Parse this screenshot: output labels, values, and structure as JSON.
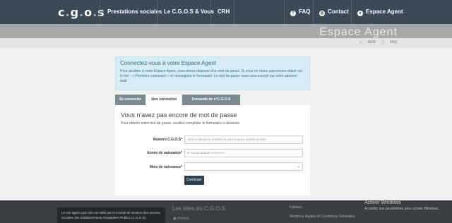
{
  "nav": {
    "logo_prefix": "c",
    "logo_mid": "g",
    "logo_suffix": "o",
    "logo_end": "s",
    "items": [
      {
        "label": "Prestations sociales"
      },
      {
        "label": "Le C.G.O.S & Vous"
      },
      {
        "label": "CRH"
      },
      {
        "label": "FAQ",
        "icon": "question-icon"
      },
      {
        "label": "Contact",
        "icon": "globe-icon"
      },
      {
        "label": "Espace Agent",
        "icon": "user-icon"
      }
    ]
  },
  "banner": {
    "title": "Espace Agent",
    "link_1": "AIDE",
    "link_2": "FAQ"
  },
  "info": {
    "title": "Connectez-vous à votre Espace Agent",
    "text": "Pour accéder à votre Espace Agent, vous devez disposer d'un mot de passe. Si vous ne l'avez pas encore cliqué sur le lien : « Première connexion » et renseignez le formulaire. Le mot de passe vous sera envoyé sur votre adresse mail."
  },
  "tabs": [
    {
      "label": "Se connecter"
    },
    {
      "label": "1ère connexion"
    },
    {
      "label": "Demande de n°C.G.O.S"
    }
  ],
  "form": {
    "title": "Vous n'avez pas encore de mot de passe",
    "subtitle": "Pour obtenir votre mot de passe, veuillez compléter le formulaire ci-dessous",
    "numero_label": "Numéro C.G.O.S",
    "numero_placeholder": "Sans 0 devant le nombre et sans espace devant la lettre",
    "annee_label": "Année de naissance",
    "annee_placeholder": "le format attendu estAAAA",
    "mois_label": "Mois de naissance",
    "mois_value": "",
    "submit_label": "Continuer"
  },
  "footer": {
    "text": "Le site agent.cgos.info est édité par le Comité de Gestion des oeuvres Sociales des Etablissements Hospitaliers Publics (C.G.O.S)",
    "sites_title": "Les sites du C.G.O.S",
    "portail": "Portail",
    "contact": "Contact",
    "mentions": "Mentions légales et Conditions Générales"
  },
  "windows": {
    "title": "Activer Windows",
    "sub": "Accédez aux paramètres pour activer Windows."
  },
  "colors": {
    "nav_bg": "#3c4a57",
    "banner_bg": "#a8a8a8",
    "info_bg": "#d7ecf5",
    "button_bg": "#2c3e50",
    "footer_bg": "#3a3e42"
  }
}
